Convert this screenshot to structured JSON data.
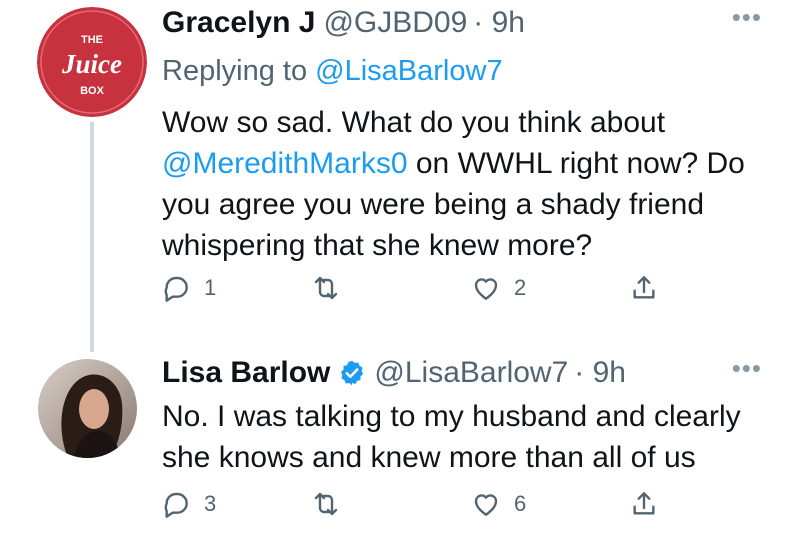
{
  "tweets": [
    {
      "author": {
        "name": "Gracelyn J",
        "handle": "@GJBD09",
        "time": "· 9h",
        "avatar_logo": {
          "top": "THE",
          "middle": "Juice",
          "bottom": "BOX"
        }
      },
      "replying_prefix": "Replying to",
      "replying_to": "@LisaBarlow7",
      "body": {
        "line1": "Wow so sad. What do you think about",
        "mention": "@MeredithMarks0",
        "line2_rest": " on WWHL right now? Do",
        "line3": "you agree you were being a shady friend",
        "line4": "whispering that she knew more?"
      },
      "actions": {
        "reply_count": "1",
        "retweet_count": "",
        "like_count": "2"
      }
    },
    {
      "author": {
        "name": "Lisa Barlow",
        "handle": "@LisaBarlow7",
        "time": "· 9h",
        "verified": true
      },
      "body": {
        "line1": "No. I was talking to my husband and clearly",
        "line2": "she knows and knew more than all of us"
      },
      "actions": {
        "reply_count": "3",
        "retweet_count": "",
        "like_count": "6"
      }
    }
  ],
  "more_label": "•••",
  "colors": {
    "link": "#1d9bf0",
    "secondary": "#536471",
    "logo_red": "#c8313e",
    "verified": "#1d9bf0"
  },
  "icons": [
    "reply-icon",
    "retweet-icon",
    "like-icon",
    "share-icon",
    "verified-badge-icon",
    "more-icon"
  ]
}
